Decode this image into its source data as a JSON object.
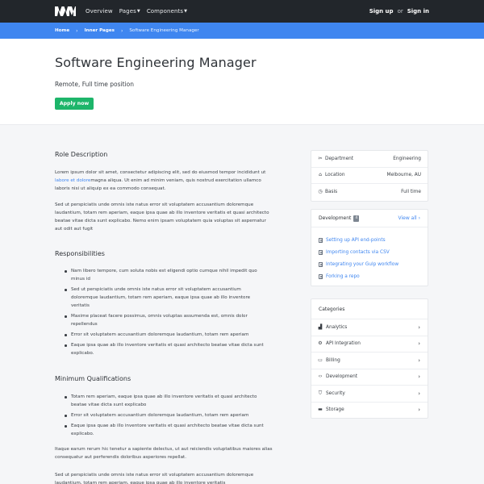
{
  "nav": {
    "links": [
      "Overview",
      "Pages",
      "Components"
    ],
    "sign_up": "Sign up",
    "or": "or",
    "sign_in": "Sign in"
  },
  "breadcrumb": {
    "home": "Home",
    "inner": "Inner Pages",
    "current": "Software Engineering Manager"
  },
  "hero": {
    "title": "Software Engineering Manager",
    "subtitle": "Remote, Full time position",
    "apply": "Apply now"
  },
  "role": {
    "heading": "Role Description",
    "p1_a": "Lorem ipsum dolor sit amet, consectetur adipiscing elit, sed do eiusmod tempor incididunt ut ",
    "p1_link": "labore et dolore",
    "p1_b": "magna aliqua. Ut enim ad minim veniam, quis nostrud exercitation ullamco laboris nisi ut aliquip ex ea commodo consequat.",
    "p2": "Sed ut perspiciatis unde omnis iste natus error sit voluptatem accusantium doloremque laudantium, totam rem aperiam, eaque ipsa quae ab illo inventore veritatis et quasi architecto beatae vitae dicta sunt explicabo. Nemo enim ipsam voluptatem quia voluptas sit aspernatur aut odit aut fugit"
  },
  "responsibilities": {
    "heading": "Responsibilities",
    "items": [
      "Nam libero tempore, cum soluta nobis est eligendi optio cumque nihil impedit quo minus id",
      "Sed ut perspiciatis unde omnis iste natus error sit voluptatem accusantium doloremque laudantium, totam rem aperiam, eaque ipsa quae ab illo inventore veritatis",
      "Maxime placeat facere possimus, omnis voluptas assumenda est, omnis dolor repellendus",
      "Error sit voluptatem accusantium doloremque laudantium, totam rem aperiam",
      "Eaque ipsa quae ab illo inventore veritatis et quasi architecto beatae vitae dicta sunt explicabo."
    ]
  },
  "qualifications": {
    "heading": "Minimum Qualifications",
    "items": [
      "Totam rem aperiam, eaque ipsa quae ab illo inventore veritatis et quasi architecto beatae vitae dicta sunt explicabo",
      "Error sit voluptatem accusantium doloremque laudantium, totam rem aperiam",
      "Eaque ipsa quae ab illo inventore veritatis et quasi architecto beatae vitae dicta sunt explicabo."
    ],
    "p1": "Itaque earum rerum hic tenetur a sapiente delectus, ut aut reiciendis voluptatibus maiores alias consequatur aut perferendis doloribus asperiores repellat.",
    "p2": "Sed ut perspiciatis unde omnis iste natus error sit voluptatem accusantium doloremque laudantium, totam rem aperiam, eaque ipsa quae ab illo inventore veritatis"
  },
  "details": {
    "department_label": "Department",
    "department_value": "Engineering",
    "location_label": "Location",
    "location_value": "Melbourne, AU",
    "basis_label": "Basis",
    "basis_value": "Full time"
  },
  "development": {
    "title": "Development",
    "count": "4",
    "view_all": "View all",
    "items": [
      "Setting up API end-points",
      "Importing contacts via CSV",
      "Integrating your Gulp workflow",
      "Forking a repo"
    ]
  },
  "categories": {
    "title": "Categories",
    "items": [
      "Analytics",
      "API Integration",
      "Billing",
      "Development",
      "Security",
      "Storage"
    ]
  },
  "colors": {
    "accent": "#3f86f0",
    "apply": "#1db56a",
    "nav": "#22262b"
  }
}
